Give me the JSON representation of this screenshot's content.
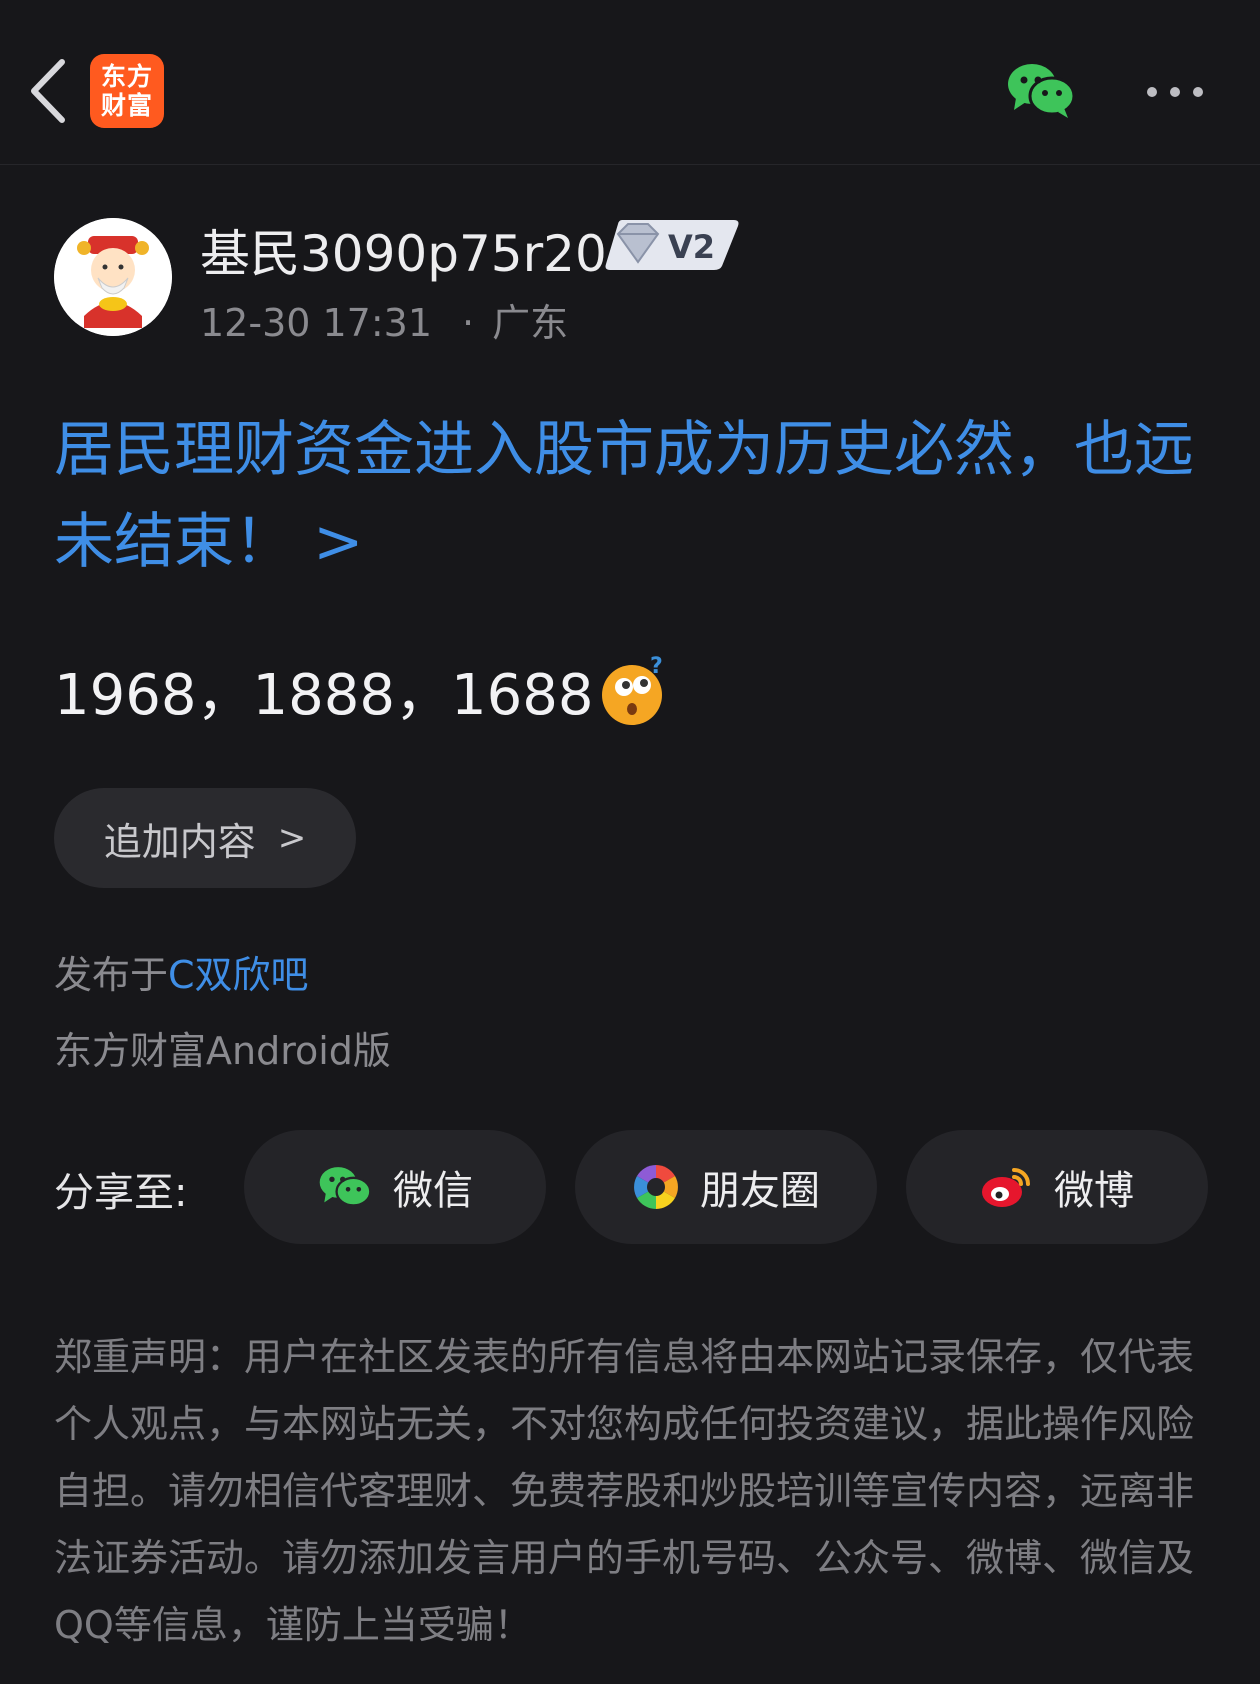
{
  "header": {
    "back_icon": "chevron-left-icon",
    "logo_line1": "东方",
    "logo_line2": "财富",
    "wechat_icon": "wechat-icon",
    "more_icon": "more-dots-icon"
  },
  "post": {
    "username": "基民3090p75r20",
    "vip_level": "V2",
    "time": "12-30 17:31",
    "separator": "·",
    "location": "广东",
    "title": "居民理财资金进入股市成为历史必然，也远未结束！ >",
    "content_text": "1968，1888，1688",
    "append_label": "追加内容",
    "append_chevron": ">",
    "published_prefix": "发布于",
    "bar_name": "C双欣吧",
    "client": "东方财富Android版"
  },
  "share": {
    "label": "分享至:",
    "buttons": [
      {
        "label": "微信",
        "icon": "wechat-icon"
      },
      {
        "label": "朋友圈",
        "icon": "moments-icon"
      },
      {
        "label": "微博",
        "icon": "weibo-icon"
      }
    ]
  },
  "disclaimer": "郑重声明：用户在社区发表的所有信息将由本网站记录保存，仅代表个人观点，与本网站无关，不对您构成任何投资建议，据此操作风险自担。请勿相信代客理财、免费荐股和炒股培训等宣传内容，远离非法证券活动。请勿添加发言用户的手机号码、公众号、微博、微信及QQ等信息，谨防上当受骗！",
  "colors": {
    "background": "#17171a",
    "link_blue": "#3f8ee6",
    "logo_orange": "#ff5a1f",
    "wechat_green": "#3ec45a"
  }
}
